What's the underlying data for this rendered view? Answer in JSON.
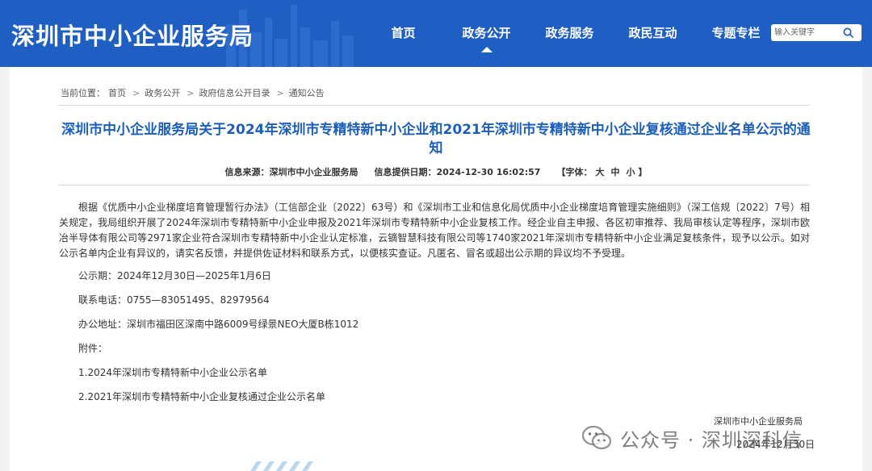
{
  "header": {
    "site_title": "深圳市中小企业服务局",
    "nav": [
      {
        "label": "首页",
        "active": false
      },
      {
        "label": "政务公开",
        "active": true
      },
      {
        "label": "政务服务",
        "active": false
      },
      {
        "label": "政民互动",
        "active": false
      },
      {
        "label": "专题专栏",
        "active": false
      }
    ],
    "search_placeholder": "输入关键字"
  },
  "breadcrumb": {
    "prefix": "当前位置：",
    "items": [
      "首页",
      "政务公开",
      "政府信息公开目录",
      "通知公告"
    ]
  },
  "article": {
    "title": "深圳市中小企业服务局关于2024年深圳市专精特新中小企业和2021年深圳市专精特新中小企业复核通过企业名单公示的通知",
    "source_label": "信息来源：",
    "source": "深圳市中小企业服务局",
    "date_label": "信息提供日期：",
    "date": "2024-12-30 16:02:57",
    "font_label": "【字体：",
    "font_sizes": [
      "大",
      "中",
      "小"
    ],
    "font_end": "】",
    "body": "根据《优质中小企业梯度培育管理暂行办法》（工信部企业〔2022〕63号）和《深圳市工业和信息化局优质中小企业梯度培育管理实施细则》（深工信规〔2022〕7号）相关规定，我局组织开展了2024年深圳市专精特新中小企业申报及2021年深圳市专精特新中小企业复核工作。经企业自主申报、各区初审推荐、我局审核认定等程序，深圳市欧冶半导体有限公司等2971家企业符合深圳市专精特新中小企业认定标准，云镝智慧科技有限公司等1740家2021年深圳市专精特新中小企业满足复核条件，现予以公示。如对公示名单内企业有异议的，请实名反馈，并提供佐证材料和联系方式，以便核实查证。凡匿名、冒名或超出公示期的异议均不予受理。",
    "period": "公示期：2024年12月30日—2025年1月6日",
    "phone": "联系电话：0755—83051495、82979564",
    "address": "办公地址：深圳市福田区深南中路6009号绿景NEO大厦B栋1012",
    "attachments_label": "附件：",
    "attachments": [
      "1.2024年深圳市专精特新中小企业公示名单",
      "2.2021年深圳市专精特新中小企业复核通过企业公示名单"
    ],
    "sign_org": "深圳市中小企业服务局",
    "sign_date": "2024年12月30日"
  },
  "watermark": {
    "text": "公众号 · 深圳深科信",
    "icon": "wechat-icon"
  },
  "colors": {
    "header_bg": "#1f5fc4",
    "title": "#1c5fb8",
    "page_bg": "#f3f3f3"
  }
}
